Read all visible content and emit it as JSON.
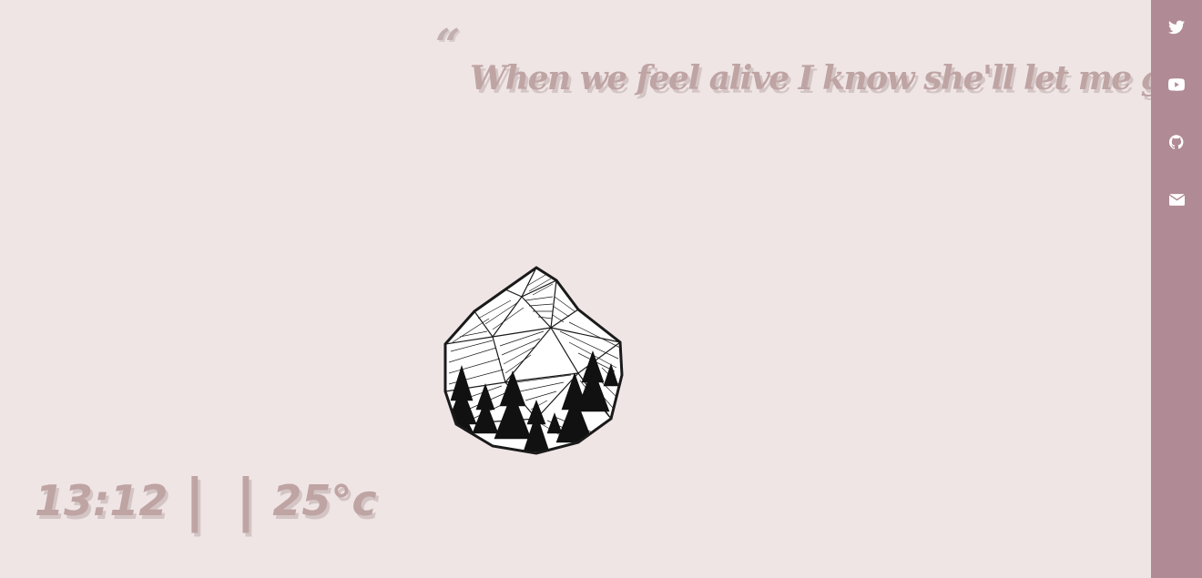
{
  "quote": {
    "mark": "“",
    "text": "When we feel alive I know she'll let me go."
  },
  "status": {
    "time": "13:12",
    "separator": "| |",
    "temperature": "25°c"
  },
  "sidebar": {
    "links": [
      {
        "name": "twitter",
        "icon": "twitter-icon"
      },
      {
        "name": "youtube",
        "icon": "youtube-icon"
      },
      {
        "name": "github",
        "icon": "github-icon"
      },
      {
        "name": "email",
        "icon": "envelope-icon"
      }
    ]
  },
  "illustration": {
    "icon": "mountain-forest-icon"
  },
  "colors": {
    "background": "#f0e5e5",
    "sidebar": "#b08a94",
    "text": "#bfa4a4",
    "text_shadow": "#d4c5c5",
    "icon": "#ffffff"
  }
}
